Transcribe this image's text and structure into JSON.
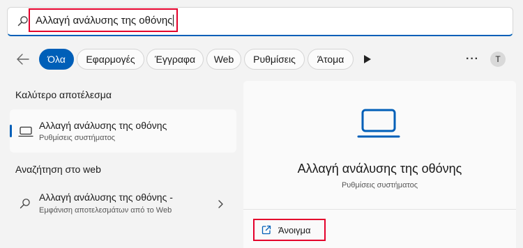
{
  "search": {
    "query": "Αλλαγή ανάλυσης της οθόνης"
  },
  "filters": {
    "items": [
      {
        "label": "Όλα",
        "active": true
      },
      {
        "label": "Εφαρμογές",
        "active": false
      },
      {
        "label": "Έγγραφα",
        "active": false
      },
      {
        "label": "Web",
        "active": false
      },
      {
        "label": "Ρυθμίσεις",
        "active": false
      },
      {
        "label": "Άτομα",
        "active": false
      }
    ],
    "more_label": "···",
    "avatar_initial": "T"
  },
  "best_match": {
    "heading": "Καλύτερο αποτέλεσμα",
    "title": "Αλλαγή ανάλυσης της οθόνης",
    "subtitle": "Ρυθμίσεις συστήματος",
    "icon": "laptop-icon"
  },
  "web_search": {
    "heading": "Αναζήτηση στο web",
    "title": "Αλλαγή ανάλυσης της οθόνης -",
    "subtitle": "Εμφάνιση αποτελεσμάτων από το Web",
    "icon": "search-icon"
  },
  "detail": {
    "title": "Αλλαγή ανάλυσης της οθόνης",
    "subtitle": "Ρυθμίσεις συστήματος",
    "icon": "laptop-icon",
    "actions": [
      {
        "label": "Άνοιγμα",
        "icon": "open-external-icon"
      }
    ]
  },
  "colors": {
    "accent": "#005fb8",
    "highlight_box": "#e4002b",
    "background": "#f3f3f3"
  }
}
